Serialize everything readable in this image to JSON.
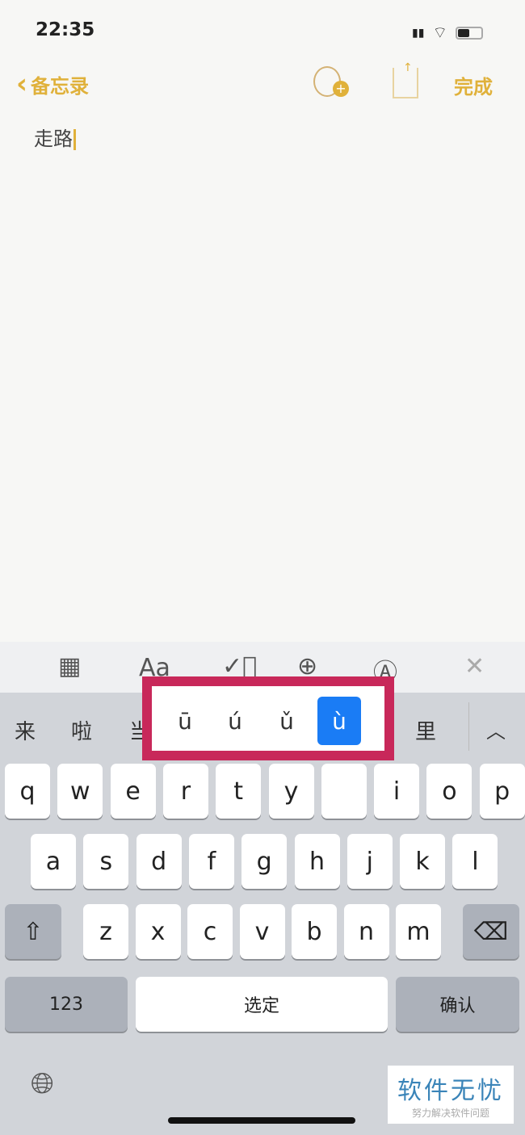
{
  "status": {
    "time": "22:35",
    "icons": [
      "signal-icon",
      "wifi-icon",
      "battery-icon"
    ]
  },
  "nav": {
    "back_label": "备忘录",
    "done_label": "完成",
    "accent": "#e0b13a"
  },
  "note": {
    "text": "走路"
  },
  "toolbar": {
    "icons": [
      "table-icon",
      "text-format-icon",
      "checklist-icon",
      "add-icon",
      "markup-icon",
      "close-icon"
    ],
    "format_label": "Aa"
  },
  "candidates": [
    "来",
    "啦",
    "当",
    "里"
  ],
  "popup": {
    "variants": [
      "ū",
      "ú",
      "ǔ",
      "ù"
    ],
    "selected": "ù",
    "selected_color": "#1a7cf5",
    "highlight_color": "#c8285a"
  },
  "keys": {
    "row1": [
      "q",
      "w",
      "e",
      "r",
      "t",
      "y",
      "",
      "i",
      "o",
      "p"
    ],
    "row2": [
      "a",
      "s",
      "d",
      "f",
      "g",
      "h",
      "j",
      "k",
      "l"
    ],
    "row3": [
      "z",
      "x",
      "c",
      "v",
      "b",
      "n",
      "m"
    ],
    "numbers": "123",
    "space": "选定",
    "confirm": "确认"
  },
  "watermark": {
    "title": "软件无忧",
    "subtitle": "努力解决软件问题"
  }
}
